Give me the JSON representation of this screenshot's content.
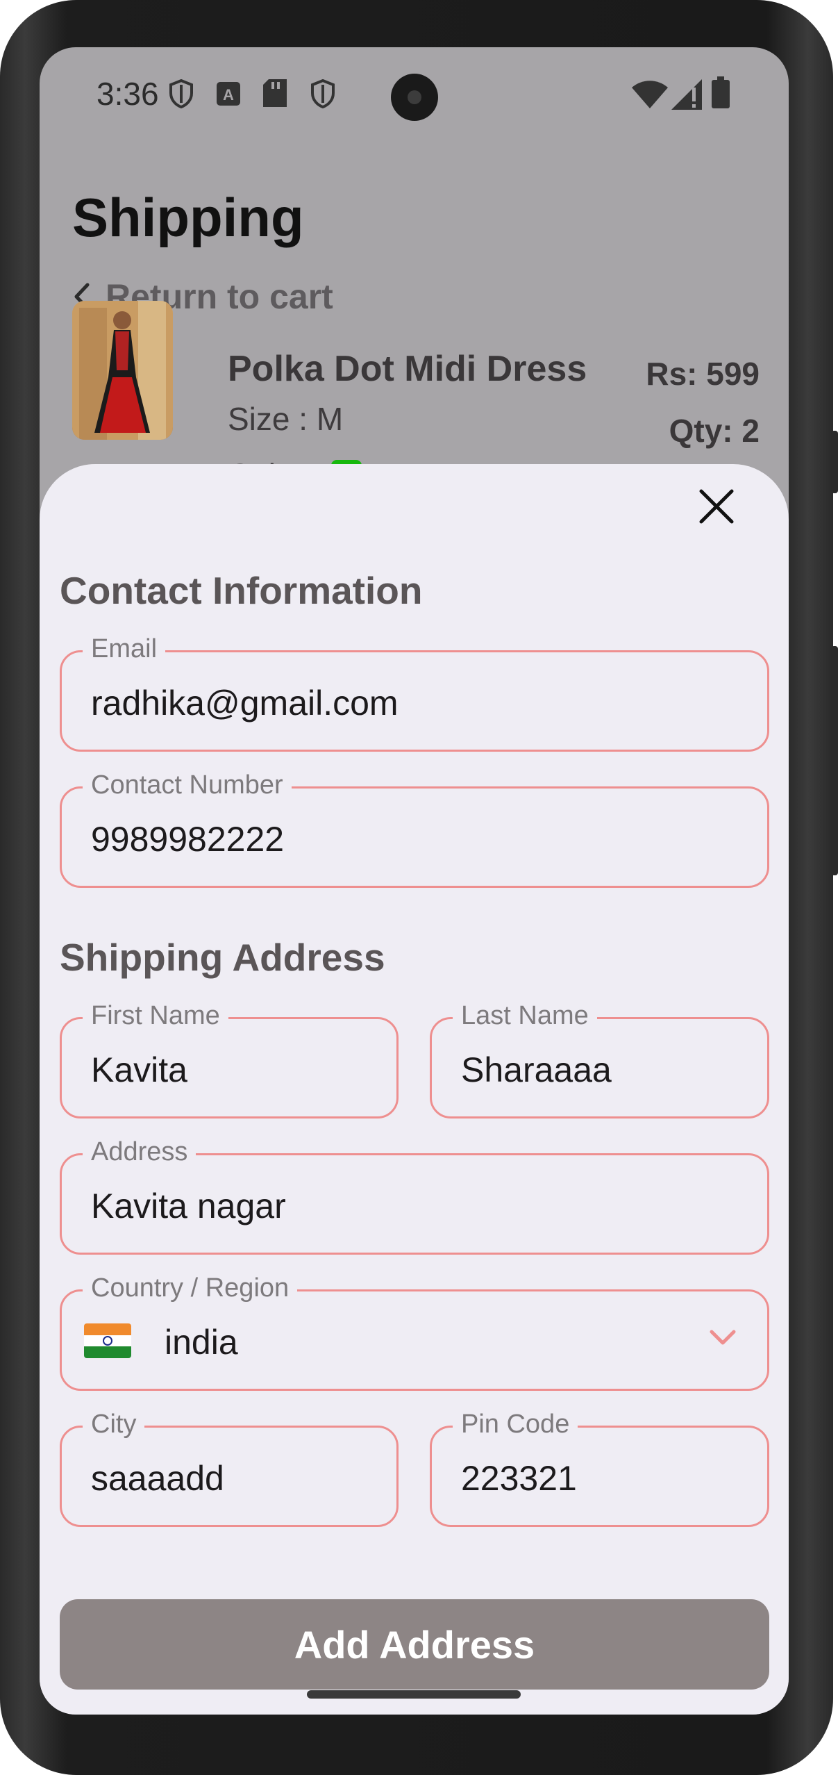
{
  "status_bar": {
    "time": "3:36",
    "left_icons": [
      "shield-icon",
      "a-box-icon",
      "sd-card-icon",
      "shield-icon"
    ],
    "right_icons": [
      "wifi-icon",
      "cell-signal-icon",
      "battery-icon"
    ]
  },
  "header": {
    "title": "Shipping",
    "return_label": "Return to cart"
  },
  "product": {
    "name": "Polka Dot Midi Dress",
    "size_label": "Size : M",
    "color_label": "Color :",
    "color_hex": "#17b80d",
    "price": "Rs: 599",
    "qty": "Qty: 2"
  },
  "sheet": {
    "contact_title": "Contact Information",
    "email": {
      "label": "Email",
      "value": "radhika@gmail.com"
    },
    "phone": {
      "label": "Contact Number",
      "value": "9989982222"
    },
    "shipping_title": "Shipping Address",
    "first_name": {
      "label": "First Name",
      "value": "Kavita"
    },
    "last_name": {
      "label": "Last Name",
      "value": "Sharaaaa"
    },
    "address": {
      "label": "Address",
      "value": "Kavita nagar"
    },
    "country": {
      "label": "Country / Region",
      "value": "india",
      "flag": "india-flag-icon"
    },
    "city": {
      "label": "City",
      "value": "saaaadd"
    },
    "pin": {
      "label": "Pin Code",
      "value": "223321"
    },
    "submit_label": "Add Address"
  },
  "colors": {
    "field_border": "#ee8f8f",
    "sheet_bg": "#efedf4",
    "overlay_bg": "#a7a5a8",
    "button_bg": "#8d8585"
  }
}
